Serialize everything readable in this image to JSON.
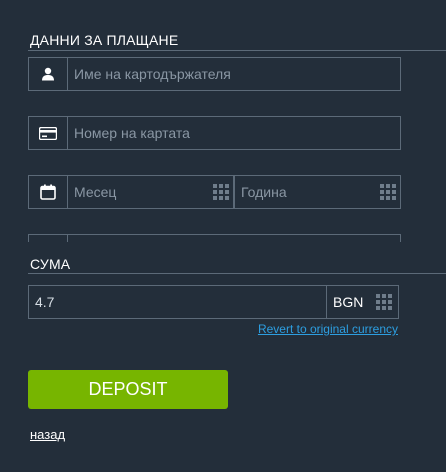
{
  "payment_section": {
    "title": "ДАННИ ЗА ПЛАЩАНЕ",
    "cardholder_placeholder": "Име на картодържателя",
    "card_number_placeholder": "Номер на картата",
    "month_placeholder": "Месец",
    "year_placeholder": "Година"
  },
  "amount_section": {
    "title": "СУМА",
    "amount_value": "4.7",
    "currency": "BGN",
    "revert_link": "Revert to original currency"
  },
  "deposit_button_label": "DEPOSIT",
  "back_link": "назад",
  "icons": {
    "cardholder": "user-icon",
    "card_number": "credit-card-icon",
    "expiry": "calendar-icon",
    "picker": "grid-icon"
  },
  "colors": {
    "background": "#232e3a",
    "border": "#5c6a78",
    "deposit_button": "#77b500",
    "link": "#2d9ee0"
  }
}
